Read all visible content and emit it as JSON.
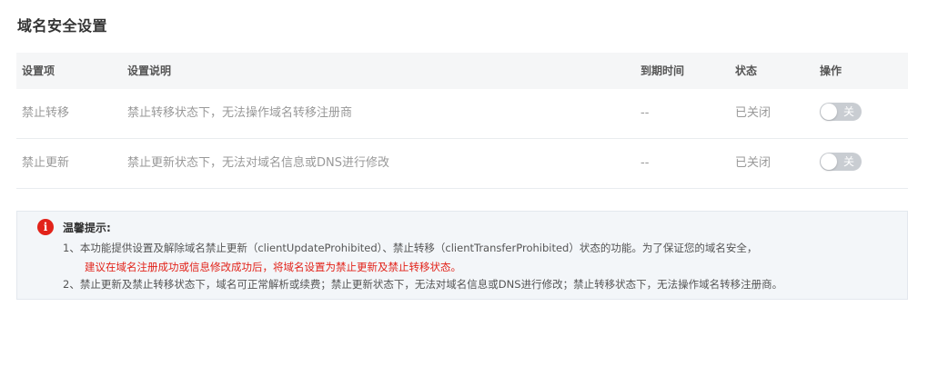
{
  "page": {
    "title": "域名安全设置"
  },
  "table": {
    "headers": [
      "设置项",
      "设置说明",
      "到期时间",
      "状态",
      "操作"
    ],
    "rows": [
      {
        "item": "禁止转移",
        "desc": "禁止转移状态下，无法操作域名转移注册商",
        "expire": "--",
        "status": "已关闭",
        "toggle_label": "关",
        "toggle_on": false
      },
      {
        "item": "禁止更新",
        "desc": "禁止更新状态下，无法对域名信息或DNS进行修改",
        "expire": "--",
        "status": "已关闭",
        "toggle_label": "关",
        "toggle_on": false
      }
    ]
  },
  "tips": {
    "icon": "info-icon",
    "icon_glyph": "i",
    "title": "温馨提示:",
    "line1": "1、本功能提供设置及解除域名禁止更新（clientUpdateProhibited）、禁止转移（clientTransferProhibited）状态的功能。为了保证您的域名安全，",
    "line2": "建议在域名注册成功或信息修改成功后，将域名设置为禁止更新及禁止转移状态。",
    "line3": "2、禁止更新及禁止转移状态下，域名可正常解析或续费；禁止更新状态下，无法对域名信息或DNS进行修改；禁止转移状态下，无法操作域名转移注册商。"
  },
  "colors": {
    "accent_red": "#e2231a",
    "header_bg": "#f5f6f7",
    "tips_bg": "#f3f6f9",
    "toggle_off": "#c9cdd2"
  }
}
